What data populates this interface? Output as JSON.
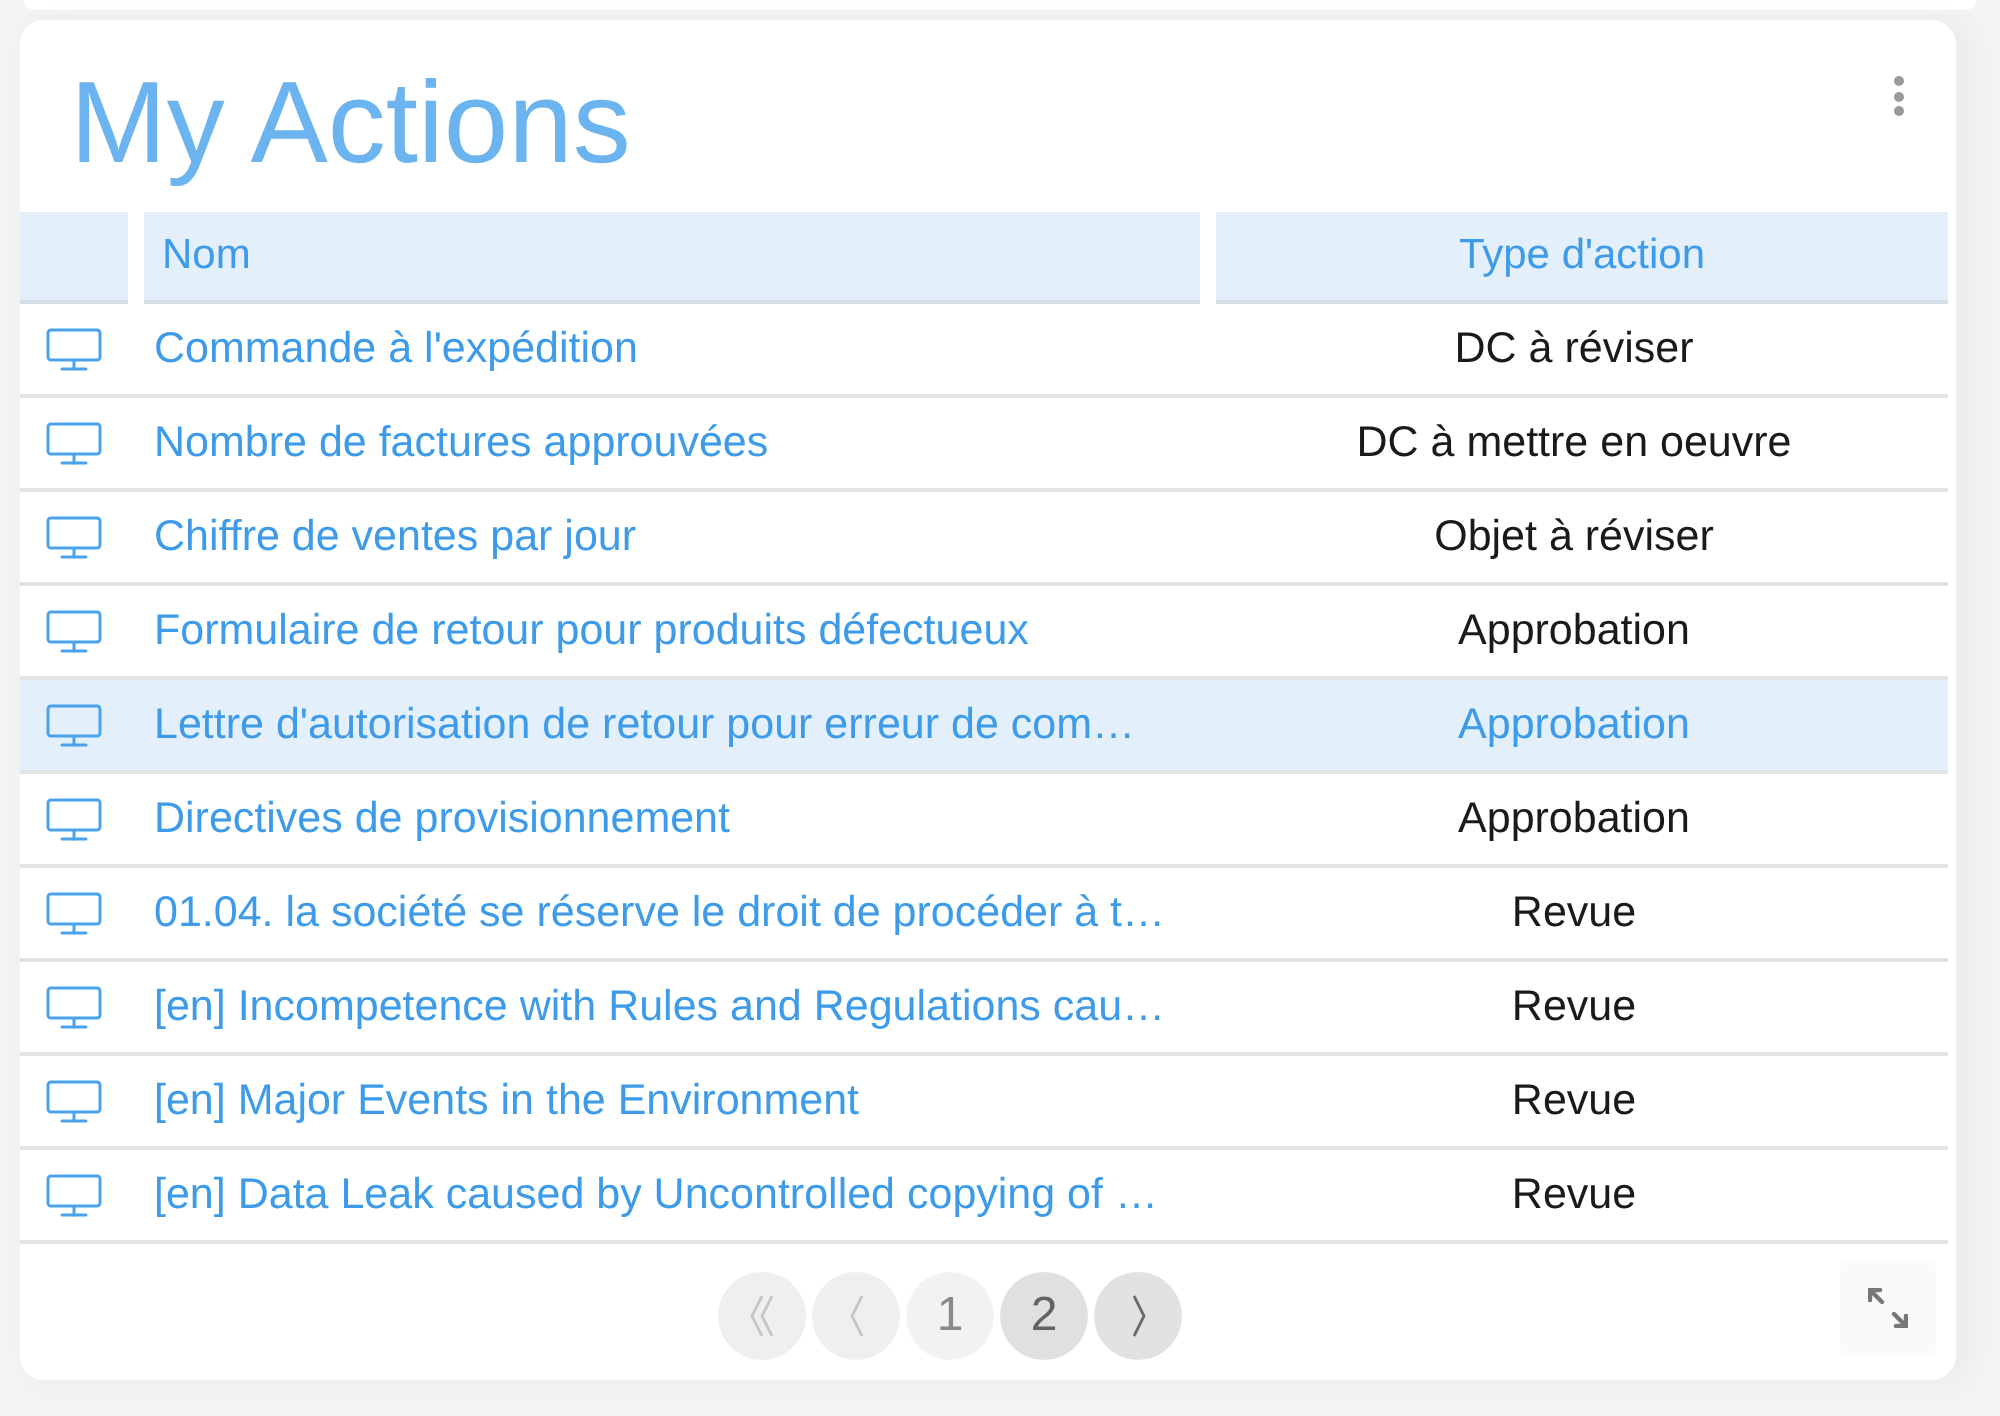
{
  "title": "My Actions",
  "table": {
    "columns": [
      "Nom",
      "Type d'action"
    ],
    "rows": [
      {
        "name": "Commande à l'expédition",
        "action_type": "DC à réviser",
        "selected": false
      },
      {
        "name": "Nombre de factures approuvées",
        "action_type": "DC à mettre en oeuvre",
        "selected": false
      },
      {
        "name": "Chiffre de ventes par jour",
        "action_type": "Objet à réviser",
        "selected": false
      },
      {
        "name": "Formulaire de retour pour produits défectueux",
        "action_type": "Approbation",
        "selected": false
      },
      {
        "name": "Lettre d'autorisation de retour pour erreur de com…",
        "action_type": "Approbation",
        "selected": true
      },
      {
        "name": "Directives de provisionnement",
        "action_type": "Approbation",
        "selected": false
      },
      {
        "name": "01.04. la société se réserve le droit de procéder à t…",
        "action_type": "Revue",
        "selected": false
      },
      {
        "name": "[en] Incompetence with Rules and Regulations cau…",
        "action_type": "Revue",
        "selected": false
      },
      {
        "name": "[en] Major Events in the Environment",
        "action_type": "Revue",
        "selected": false
      },
      {
        "name": "[en] Data Leak caused by Uncontrolled copying of …",
        "action_type": "Revue",
        "selected": false
      }
    ]
  },
  "pagination": {
    "first": {
      "disabled": true
    },
    "previous": {
      "disabled": true
    },
    "pages": [
      {
        "label": "1",
        "selected": false
      },
      {
        "label": "2",
        "selected": true
      }
    ],
    "next": {
      "disabled": false
    }
  }
}
